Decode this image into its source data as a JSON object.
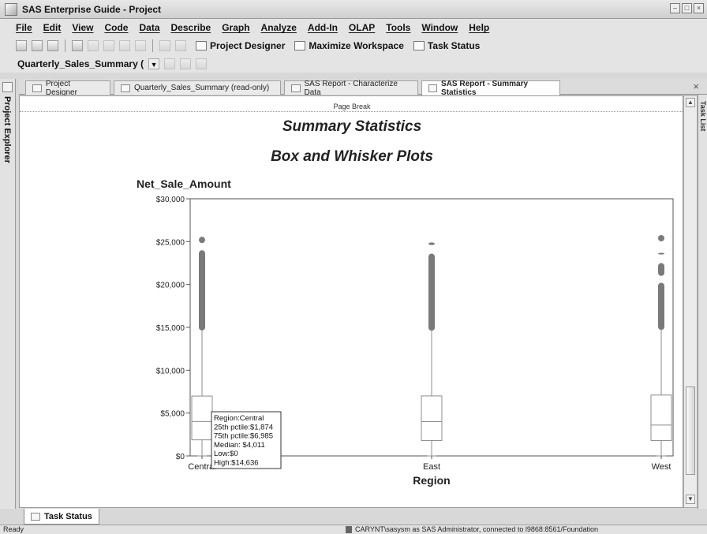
{
  "window": {
    "title": "SAS Enterprise Guide - Project"
  },
  "menu": [
    "File",
    "Edit",
    "View",
    "Code",
    "Data",
    "Describe",
    "Graph",
    "Analyze",
    "Add-In",
    "OLAP",
    "Tools",
    "Window",
    "Help"
  ],
  "toolbar": {
    "project_designer": "Project Designer",
    "maximize_workspace": "Maximize Workspace",
    "task_status": "Task Status"
  },
  "combo": {
    "value": "Quarterly_Sales_Summary ("
  },
  "sidebar": {
    "label": "Project Explorer"
  },
  "right_panel": {
    "label": "Task List"
  },
  "tabs": [
    {
      "label": "Project Designer"
    },
    {
      "label": "Quarterly_Sales_Summary (read-only)"
    },
    {
      "label": "SAS Report - Characterize Data"
    },
    {
      "label": "SAS Report - Summary Statistics"
    }
  ],
  "report": {
    "page_break": "Page Break",
    "title": "Summary Statistics",
    "subtitle": "Box and Whisker Plots"
  },
  "chart_data": {
    "type": "box",
    "ylabel": "Net_Sale_Amount",
    "xlabel": "Region",
    "ylim": [
      0,
      30000
    ],
    "yticks": [
      "$0",
      "$5,000",
      "$10,000",
      "$15,000",
      "$20,000",
      "$25,000",
      "$30,000"
    ],
    "categories": [
      "Central",
      "East",
      "West"
    ],
    "boxes": [
      {
        "name": "Central",
        "low": 0,
        "q1": 1874,
        "median": 4011,
        "q3": 6985,
        "high": 14636,
        "outliers": [
          {
            "from": 14636,
            "to": 24000
          },
          {
            "from": 25200,
            "to": 25200
          }
        ]
      },
      {
        "name": "East",
        "low": 0,
        "q1": 1800,
        "median": 4000,
        "q3": 7000,
        "high": 14600,
        "outliers": [
          {
            "from": 14600,
            "to": 23600
          },
          {
            "from": 24600,
            "to": 24900
          }
        ]
      },
      {
        "name": "West",
        "low": 0,
        "q1": 1800,
        "median": 3600,
        "q3": 7100,
        "high": 14700,
        "outliers": [
          {
            "from": 14700,
            "to": 20200
          },
          {
            "from": 21000,
            "to": 22500
          },
          {
            "from": 23500,
            "to": 23700
          },
          {
            "from": 25400,
            "to": 25400
          }
        ]
      }
    ],
    "tooltip": [
      "Region:Central",
      "25th pctile:$1,874",
      "75th pctile:$6,985",
      "Median: $4,011",
      "Low:$0",
      "High:$14,636"
    ],
    "colors": {
      "outlier": "#7a7a7a",
      "box": "#8c8c8c",
      "axis": "#555555"
    }
  },
  "bottom_tab": {
    "label": "Task Status"
  },
  "status": {
    "left": "Ready",
    "right": "CARYNT\\sasysm as SAS Administrator, connected to l9868:8561/Foundation"
  }
}
